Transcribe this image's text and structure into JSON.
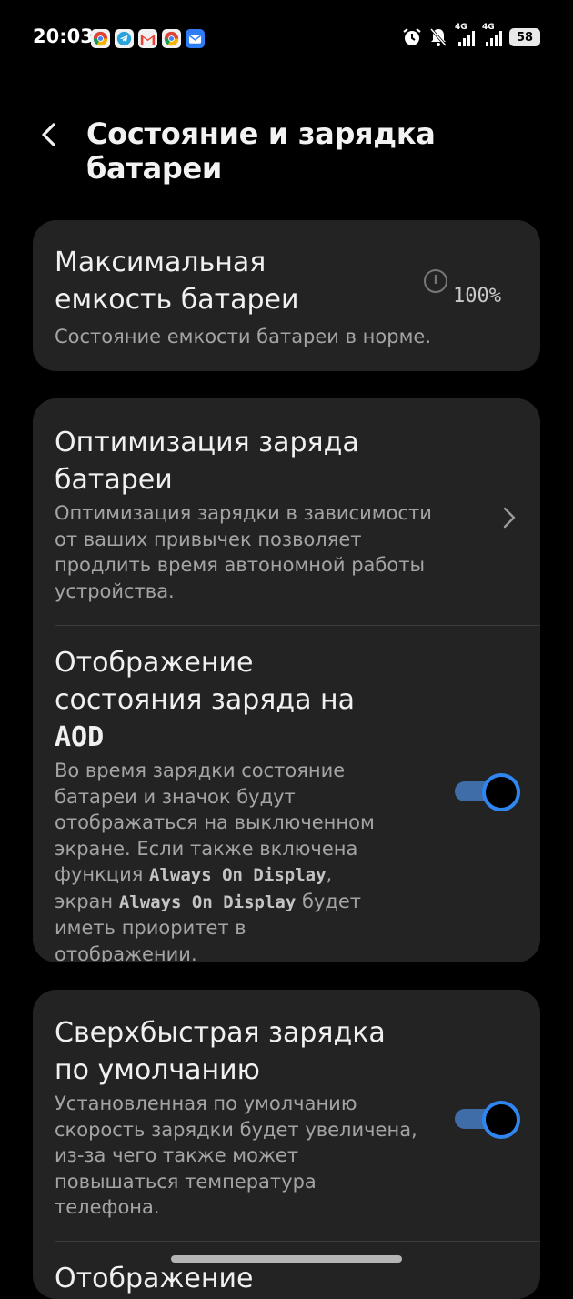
{
  "status_bar": {
    "time": "20:03",
    "notification_icons": [
      "chrome-icon",
      "telegram-icon",
      "gmail-icon",
      "chrome-icon",
      "mail-icon"
    ],
    "network_1": "4G",
    "network_2": "4G",
    "battery_level": "58"
  },
  "header": {
    "title": "Состояние и зарядка батареи"
  },
  "capacity": {
    "title": "Максимальная емкость батареи",
    "description": "Состояние емкости батареи в норме.",
    "value": "100%"
  },
  "optimization": {
    "title": "Оптимизация заряда батареи",
    "description": "Оптимизация зарядки в зависимости от ваших привычек позволяет продлить время автономной работы устройства."
  },
  "aod": {
    "title_part1": "Отображение состояния заряда на ",
    "title_part2": "AOD",
    "desc_part1": "Во время зарядки состояние батареи и значок будут отображаться на выключенном экране. Если также включена функция ",
    "desc_aod1": "Always On Display",
    "desc_part2": ", экран ",
    "desc_aod2": "Always On Display",
    "desc_part3": " будет иметь приоритет в отображении.",
    "enabled": true
  },
  "superfast": {
    "title": "Сверхбыстрая зарядка по умолчанию",
    "description": "Установленная по умолчанию скорость зарядки будет увеличена, из-за чего также может повышаться температура телефона.",
    "enabled": true
  },
  "next_item": {
    "title": "Отображение"
  },
  "colors": {
    "background": "#000000",
    "card": "#232323",
    "toggle_track": "#3e6da8",
    "toggle_ring": "#2f86f0",
    "secondary_text": "#a4a4a4"
  }
}
